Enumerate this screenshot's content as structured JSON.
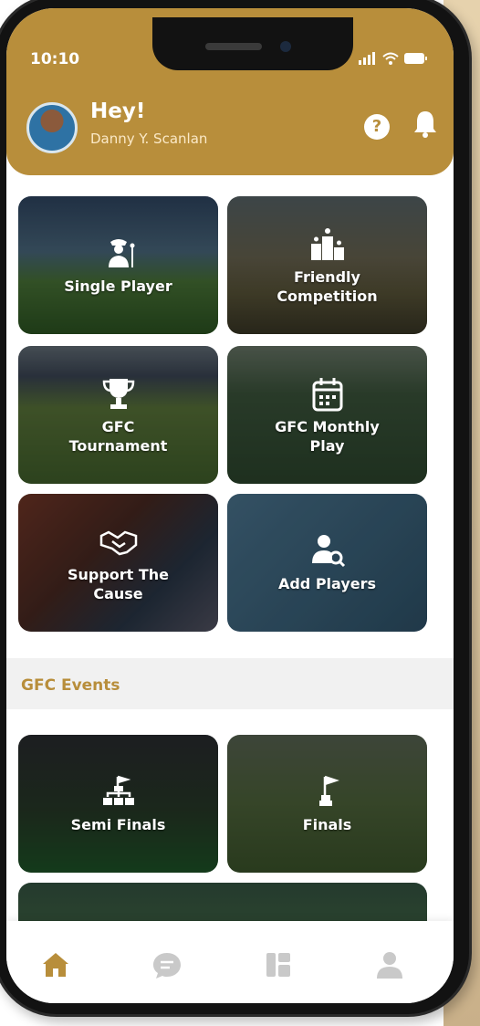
{
  "status": {
    "time": "10:10"
  },
  "header": {
    "greeting": "Hey!",
    "username": "Danny Y. Scanlan",
    "help_label": "?"
  },
  "tiles": [
    {
      "label": "Single Player",
      "icon": "golfer-icon"
    },
    {
      "label": "Friendly Competition",
      "icon": "podium-icon"
    },
    {
      "label": "GFC Tournament",
      "icon": "trophy-icon"
    },
    {
      "label": "GFC Monthly Play",
      "icon": "calendar-icon"
    },
    {
      "label": "Support The Cause",
      "icon": "handshake-icon"
    },
    {
      "label": "Add Players",
      "icon": "user-search-icon"
    }
  ],
  "events": {
    "title": "GFC Events",
    "items": [
      {
        "label": "Semi Finals",
        "icon": "bracket-icon"
      },
      {
        "label": "Finals",
        "icon": "flag-bracket-icon"
      }
    ]
  },
  "nav": [
    {
      "name": "home",
      "icon": "home-icon",
      "active": true
    },
    {
      "name": "chat",
      "icon": "chat-icon",
      "active": false
    },
    {
      "name": "dashboard",
      "icon": "dashboard-icon",
      "active": false
    },
    {
      "name": "profile",
      "icon": "user-icon",
      "active": false
    }
  ],
  "colors": {
    "brand": "#b88e3b",
    "nav_inactive": "#c9c9c9"
  }
}
